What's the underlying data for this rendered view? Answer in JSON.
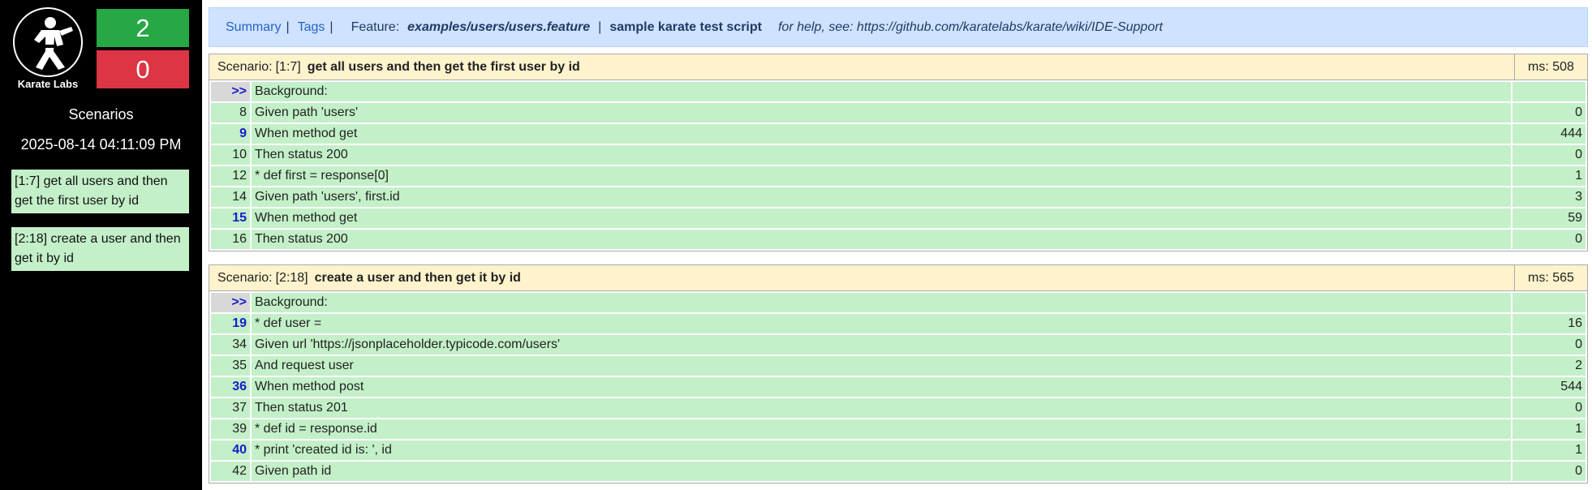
{
  "sidebar": {
    "logo_text": "Karate Labs",
    "passed": "2",
    "failed": "0",
    "heading": "Scenarios",
    "date": "2025-08-14 04:11:09 PM",
    "links": [
      "[1:7] get all users and then get the first user by id",
      "[2:18] create a user and then get it by id"
    ]
  },
  "topbar": {
    "summary": "Summary",
    "tags": "Tags",
    "sep": "|",
    "feature_label": "Feature:",
    "feature_path": "examples/users/users.feature",
    "feature_name": "sample karate test script",
    "help": "for help, see: https://github.com/karatelabs/karate/wiki/IDE-Support"
  },
  "scenarios": [
    {
      "label": "Scenario:",
      "ref": "[1:7]",
      "name": "get all users and then get the first user by id",
      "ms": "ms: 508",
      "steps": [
        {
          "line": ">>",
          "text": "Background:",
          "ms": "",
          "kind": "bg"
        },
        {
          "line": "8",
          "text": "Given path 'users'",
          "ms": "0",
          "kind": ""
        },
        {
          "line": "9",
          "text": "When method get",
          "ms": "444",
          "kind": "hi"
        },
        {
          "line": "10",
          "text": "Then status 200",
          "ms": "0",
          "kind": ""
        },
        {
          "line": "12",
          "text": "* def first = response[0]",
          "ms": "1",
          "kind": ""
        },
        {
          "line": "14",
          "text": "Given path 'users', first.id",
          "ms": "3",
          "kind": ""
        },
        {
          "line": "15",
          "text": "When method get",
          "ms": "59",
          "kind": "hi"
        },
        {
          "line": "16",
          "text": "Then status 200",
          "ms": "0",
          "kind": ""
        }
      ]
    },
    {
      "label": "Scenario:",
      "ref": "[2:18]",
      "name": "create a user and then get it by id",
      "ms": "ms: 565",
      "steps": [
        {
          "line": ">>",
          "text": "Background:",
          "ms": "",
          "kind": "bg"
        },
        {
          "line": "19",
          "text": "* def user =",
          "ms": "16",
          "kind": "hi"
        },
        {
          "line": "34",
          "text": "Given url 'https://jsonplaceholder.typicode.com/users'",
          "ms": "0",
          "kind": ""
        },
        {
          "line": "35",
          "text": "And request user",
          "ms": "2",
          "kind": ""
        },
        {
          "line": "36",
          "text": "When method post",
          "ms": "544",
          "kind": "hi"
        },
        {
          "line": "37",
          "text": "Then status 201",
          "ms": "0",
          "kind": ""
        },
        {
          "line": "39",
          "text": "* def id = response.id",
          "ms": "1",
          "kind": ""
        },
        {
          "line": "40",
          "text": "* print 'created id is: ', id",
          "ms": "1",
          "kind": "hi"
        },
        {
          "line": "42",
          "text": "Given path id",
          "ms": "0",
          "kind": ""
        }
      ]
    }
  ]
}
